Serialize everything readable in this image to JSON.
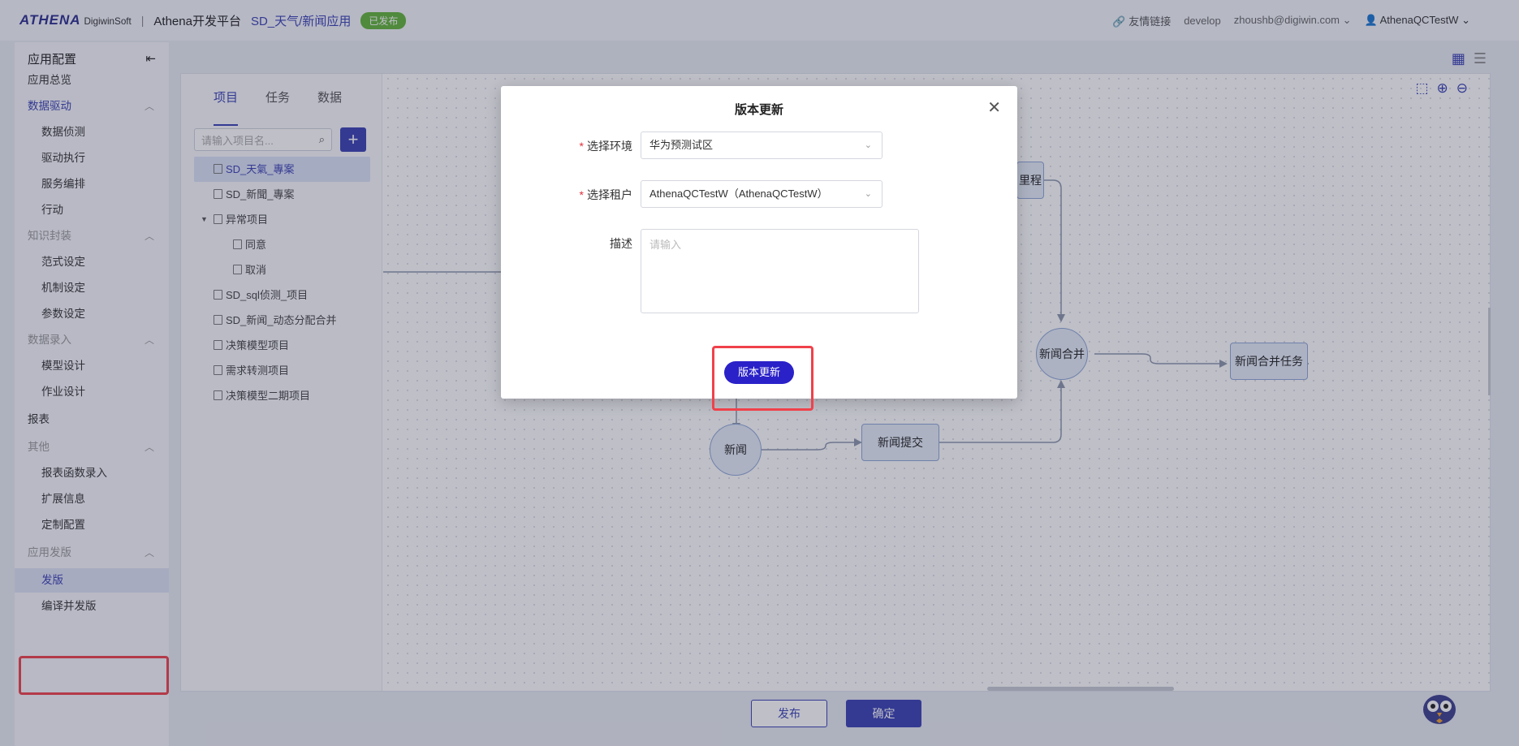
{
  "header": {
    "logo_text": "ATHENA",
    "logo_sub": "DigiwinSoft",
    "platform": "Athena开发平台",
    "app_name": "SD_天气/新闻应用",
    "status_badge": "已发布",
    "links": {
      "friend": "友情链接",
      "env": "develop",
      "email": "zhoushb@digiwin.com",
      "user": "AthenaQCTestW"
    }
  },
  "sidebar": {
    "title": "应用配置",
    "items": [
      {
        "label": "应用总览",
        "type": "top"
      },
      {
        "label": "数据驱动",
        "type": "group-active"
      },
      {
        "label": "数据侦测",
        "type": "sub"
      },
      {
        "label": "驱动执行",
        "type": "sub"
      },
      {
        "label": "服务编排",
        "type": "sub"
      },
      {
        "label": "行动",
        "type": "sub"
      },
      {
        "label": "知识封装",
        "type": "group"
      },
      {
        "label": "范式设定",
        "type": "sub"
      },
      {
        "label": "机制设定",
        "type": "sub"
      },
      {
        "label": "参数设定",
        "type": "sub"
      },
      {
        "label": "数据录入",
        "type": "group"
      },
      {
        "label": "模型设计",
        "type": "sub"
      },
      {
        "label": "作业设计",
        "type": "sub"
      },
      {
        "label": "报表",
        "type": "top"
      },
      {
        "label": "其他",
        "type": "group"
      },
      {
        "label": "报表函数录入",
        "type": "sub"
      },
      {
        "label": "扩展信息",
        "type": "sub"
      },
      {
        "label": "定制配置",
        "type": "sub"
      },
      {
        "label": "应用发版",
        "type": "group"
      },
      {
        "label": "发版",
        "type": "sub-active"
      },
      {
        "label": "编译并发版",
        "type": "sub"
      }
    ]
  },
  "tree_panel": {
    "tabs": [
      "项目",
      "任务",
      "数据"
    ],
    "search_placeholder": "请输入项目名...",
    "items": [
      {
        "label": "SD_天氣_專案",
        "level": 1,
        "selected": true
      },
      {
        "label": "SD_新聞_專案",
        "level": 1
      },
      {
        "label": "异常项目",
        "level": 1,
        "expanded": true
      },
      {
        "label": "同意",
        "level": 2
      },
      {
        "label": "取消",
        "level": 2
      },
      {
        "label": "SD_sql侦测_项目",
        "level": 1
      },
      {
        "label": "SD_新闻_动态分配合并",
        "level": 1
      },
      {
        "label": "决策模型项目",
        "level": 1
      },
      {
        "label": "需求转测项目",
        "level": 1
      },
      {
        "label": "决策模型二期项目",
        "level": 1
      }
    ]
  },
  "canvas": {
    "nodes": {
      "milestone": "里程",
      "news_merge": "新闻合并",
      "news_merge_task": "新闻合并任务",
      "news": "新闻",
      "news_submit": "新闻提交"
    }
  },
  "footer": {
    "publish": "发布",
    "confirm": "确定"
  },
  "modal": {
    "title": "版本更新",
    "env_label": "选择环境",
    "env_value": "华为预测试区",
    "tenant_label": "选择租户",
    "tenant_value": "AthenaQCTestW（AthenaQCTestW）",
    "desc_label": "描述",
    "desc_placeholder": "请输入",
    "submit_label": "版本更新"
  },
  "colors": {
    "brand": "#3a41b4",
    "published": "#62b33a",
    "highlight": "#f0414b",
    "modal_button": "#2a21c9"
  }
}
